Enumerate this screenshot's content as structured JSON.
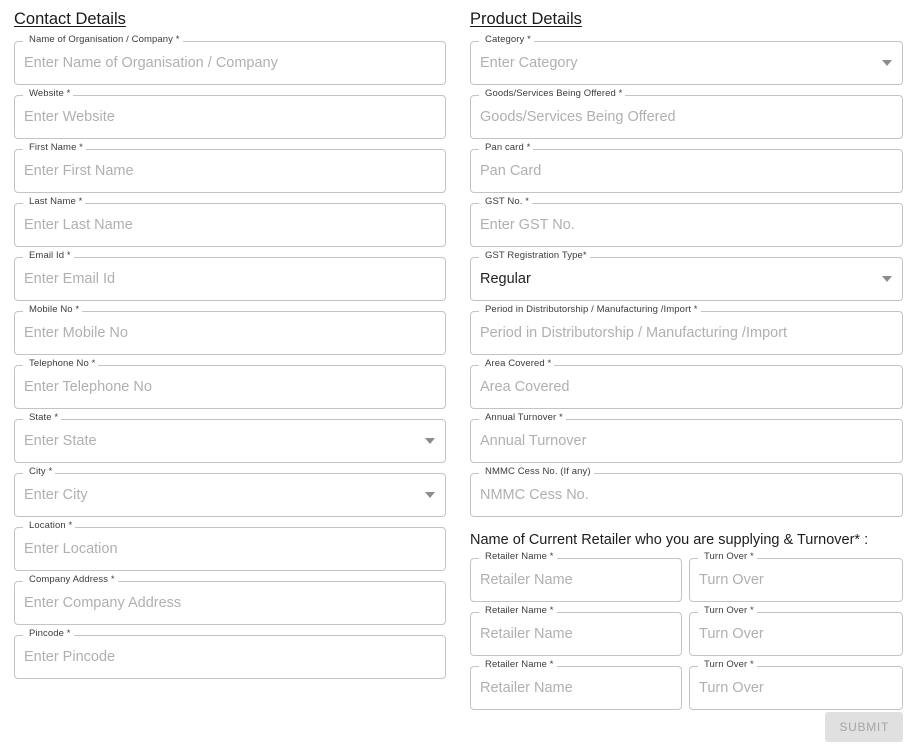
{
  "contact": {
    "title": "Contact Details",
    "fields": [
      {
        "label": "Name of Organisation / Company *",
        "placeholder": "Enter Name of Organisation / Company",
        "type": "text"
      },
      {
        "label": "Website *",
        "placeholder": "Enter Website",
        "type": "text"
      },
      {
        "label": "First Name *",
        "placeholder": "Enter First Name",
        "type": "text"
      },
      {
        "label": "Last Name *",
        "placeholder": "Enter Last Name",
        "type": "text"
      },
      {
        "label": "Email Id *",
        "placeholder": "Enter Email Id",
        "type": "text"
      },
      {
        "label": "Mobile No *",
        "placeholder": "Enter Mobile No",
        "type": "text"
      },
      {
        "label": "Telephone No *",
        "placeholder": "Enter Telephone No",
        "type": "text"
      },
      {
        "label": "State *",
        "placeholder": "Enter State",
        "type": "select"
      },
      {
        "label": "City *",
        "placeholder": "Enter City",
        "type": "select"
      },
      {
        "label": "Location *",
        "placeholder": "Enter Location",
        "type": "text"
      },
      {
        "label": "Company Address *",
        "placeholder": "Enter Company Address",
        "type": "text"
      },
      {
        "label": "Pincode *",
        "placeholder": "Enter Pincode",
        "type": "text"
      }
    ]
  },
  "product": {
    "title": "Product Details",
    "fields": [
      {
        "label": "Category *",
        "placeholder": "Enter Category",
        "type": "select"
      },
      {
        "label": "Goods/Services Being Offered *",
        "placeholder": "Goods/Services Being Offered",
        "type": "text"
      },
      {
        "label": "Pan card *",
        "placeholder": "Pan Card",
        "type": "text"
      },
      {
        "label": "GST No. *",
        "placeholder": "Enter GST No.",
        "type": "text"
      },
      {
        "label": "GST Registration Type*",
        "value": "Regular",
        "type": "select"
      },
      {
        "label": "Period in Distributorship / Manufacturing /Import *",
        "placeholder": "Period in Distributorship / Manufacturing /Import",
        "type": "text"
      },
      {
        "label": "Area Covered *",
        "placeholder": "Area Covered",
        "type": "text"
      },
      {
        "label": "Annual Turnover *",
        "placeholder": "Annual Turnover",
        "type": "text"
      },
      {
        "label": "NMMC Cess No. (If any)",
        "placeholder": "NMMC Cess No.",
        "type": "text"
      }
    ],
    "retailer_section_title": "Name of Current Retailer who you are supplying & Turnover* :",
    "retailer_rows": [
      {
        "name_label": "Retailer Name *",
        "name_placeholder": "Retailer Name",
        "turn_label": "Turn Over *",
        "turn_placeholder": "Turn Over"
      },
      {
        "name_label": "Retailer Name *",
        "name_placeholder": "Retailer Name",
        "turn_label": "Turn Over *",
        "turn_placeholder": "Turn Over"
      },
      {
        "name_label": "Retailer Name *",
        "name_placeholder": "Retailer Name",
        "turn_label": "Turn Over *",
        "turn_placeholder": "Turn Over"
      }
    ]
  },
  "actions": {
    "submit_label": "SUBMIT",
    "submit_enabled": false
  },
  "colors": {
    "border": "#c4c4c4",
    "label_text": "#3c3c3c",
    "placeholder_text": "#b0b0b0",
    "value_text": "#222222",
    "submit_bg": "#e0e0e0",
    "submit_text": "#a6a6a6",
    "page_bg": "#ffffff"
  }
}
